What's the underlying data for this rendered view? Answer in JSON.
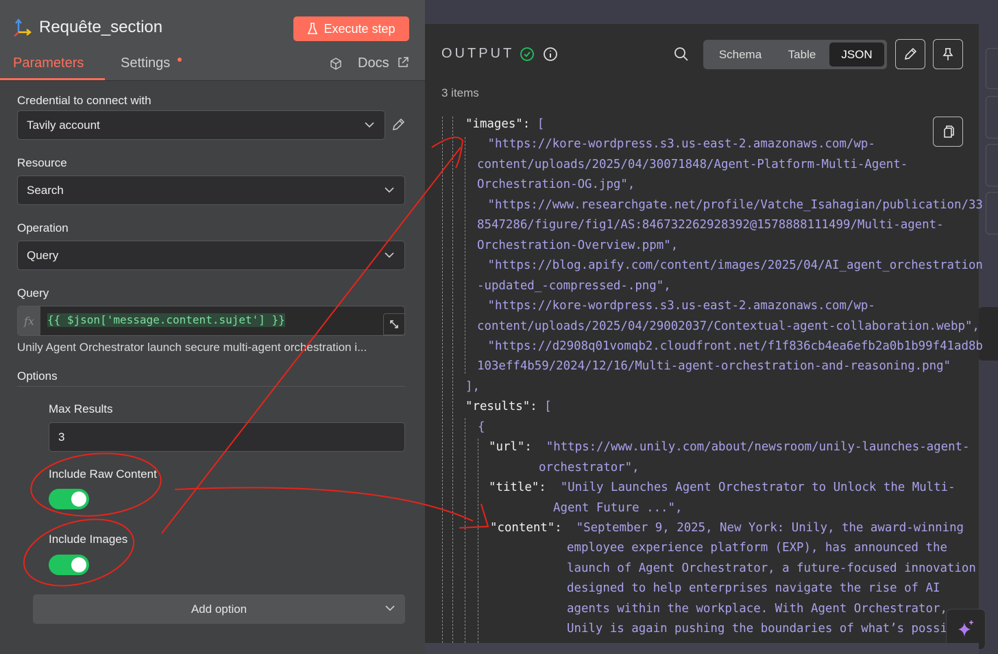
{
  "node": {
    "title": "Requête_section",
    "execute_label": "Execute step"
  },
  "tabs": {
    "parameters": "Parameters",
    "settings": "Settings",
    "docs": "Docs"
  },
  "form": {
    "credential_label": "Credential to connect with",
    "credential_value": "Tavily account",
    "resource_label": "Resource",
    "resource_value": "Search",
    "operation_label": "Operation",
    "operation_value": "Query",
    "query_label": "Query",
    "query_fx": "fx",
    "query_expression": "{{ $json['message.content.sujet'] }}",
    "query_preview": "Unily Agent Orchestrator launch secure multi-agent orchestration i...",
    "options_label": "Options",
    "max_results_label": "Max Results",
    "max_results_value": "3",
    "raw_content_label": "Include Raw Content",
    "raw_content_on": true,
    "images_label": "Include Images",
    "images_on": true,
    "add_option_label": "Add option"
  },
  "output": {
    "title": "OUTPUT",
    "count": "3 items",
    "views": [
      "Schema",
      "Table",
      "JSON"
    ],
    "active_view": "JSON",
    "lines": [
      {
        "k": "\"images\": ",
        "v": "["
      },
      {
        "v": " \"https://kore-wordpress.s3.us-east-2.amazonaws.com/wp-"
      },
      {
        "v": "content/uploads/2025/04/30071848/Agent-Platform-Multi-Agent-"
      },
      {
        "v": "Orchestration-OG.jpg\","
      },
      {
        "v": " \"https://www.researchgate.net/profile/Vatche_Isahagian/publication/33"
      },
      {
        "v": "8547286/figure/fig1/AS:846732262928392@1578888111499/Multi-agent-"
      },
      {
        "v": "Orchestration-Overview.ppm\","
      },
      {
        "v": " \"https://blog.apify.com/content/images/2025/04/AI_agent_orchestration"
      },
      {
        "v": "-updated_-compressed-.png\","
      },
      {
        "v": " \"https://kore-wordpress.s3.us-east-2.amazonaws.com/wp-"
      },
      {
        "v": "content/uploads/2025/04/29002037/Contextual-agent-collaboration.webp\","
      },
      {
        "v": " \"https://d2908q01vomqb2.cloudfront.net/f1f836cb4ea6efb2a0b1b99f41ad8b"
      },
      {
        "v": "103eff4b59/2024/12/16/Multi-agent-orchestration-and-reasoning.png\""
      },
      {
        "v": "],"
      },
      {
        "k": "\"results\": ",
        "v": "["
      },
      {
        "v": "{"
      },
      {
        "k": "\"url\":  ",
        "v": "\"https://www.unily.com/about/newsroom/unily-launches-agent-"
      },
      {
        "v": "orchestrator\","
      },
      {
        "k": "\"title\":  ",
        "v": "\"Unily Launches Agent Orchestrator to Unlock the Multi-"
      },
      {
        "v": "Agent Future ...\","
      },
      {
        "k": "\"content\":  ",
        "v": "\"September 9, 2025, New York: Unily, the award-winning"
      },
      {
        "v": "employee experience platform (EXP), has announced the"
      },
      {
        "v": "launch of Agent Orchestrator, a future-focused innovation"
      },
      {
        "v": "designed to help enterprises navigate the rise of AI"
      },
      {
        "v": "agents within the workplace. With Agent Orchestrator,"
      },
      {
        "v": "Unily is again pushing the boundaries of what’s possi"
      }
    ]
  },
  "colors": {
    "accent": "#ff6e5a",
    "toggle_on": "#20c45e",
    "json_string": "#a9a2ec",
    "annotation": "#e8241a"
  }
}
